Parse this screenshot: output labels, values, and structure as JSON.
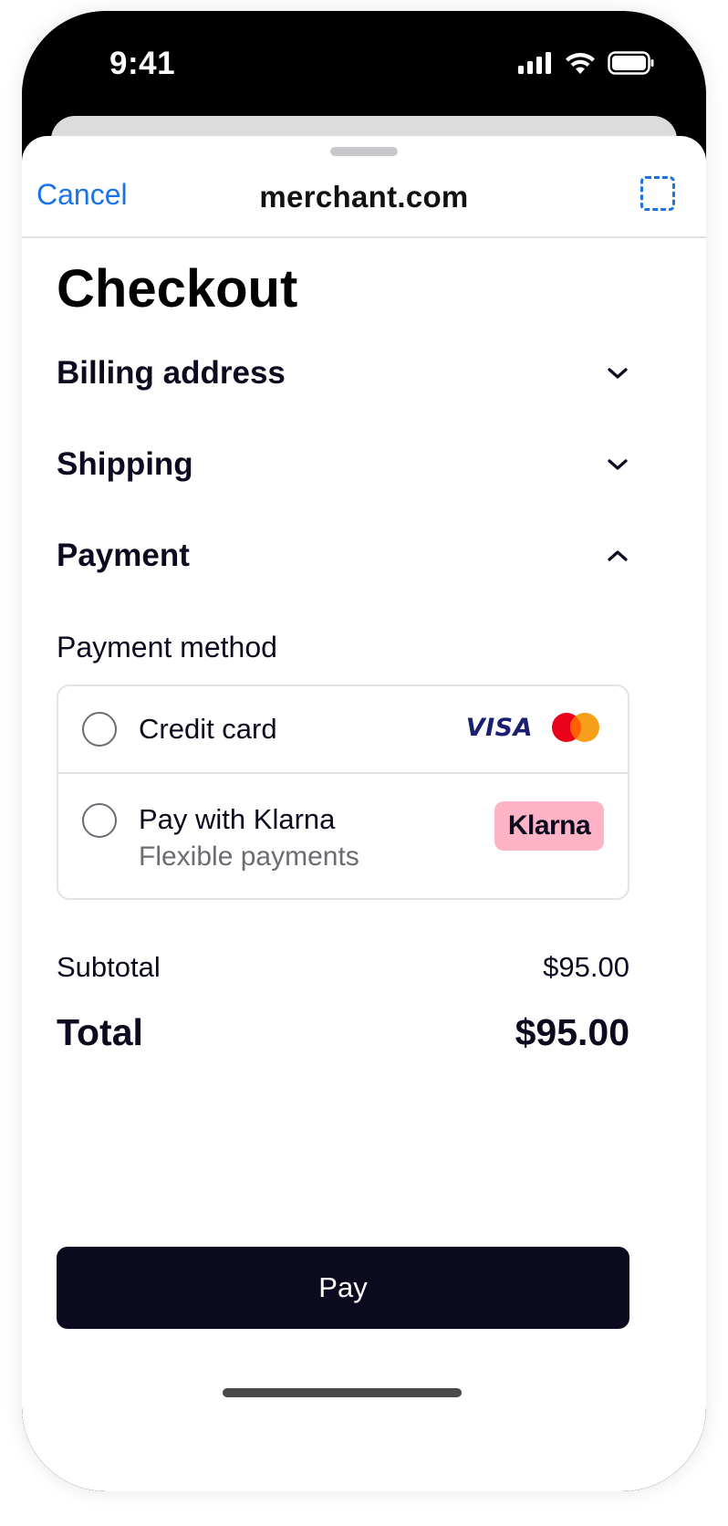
{
  "status_bar": {
    "time": "9:41"
  },
  "nav": {
    "cancel_label": "Cancel",
    "domain": "merchant.com"
  },
  "page": {
    "title": "Checkout"
  },
  "sections": [
    {
      "title": "Billing address",
      "state": "collapsed"
    },
    {
      "title": "Shipping",
      "state": "collapsed"
    },
    {
      "title": "Payment",
      "state": "expanded"
    }
  ],
  "payment": {
    "method_label": "Payment method",
    "methods": [
      {
        "label": "Credit card",
        "selected": false,
        "logos": [
          "VISA",
          "mastercard"
        ]
      },
      {
        "label": "Pay with Klarna",
        "sublabel": "Flexible payments",
        "selected": false,
        "badge": "Klarna"
      }
    ]
  },
  "summary": {
    "subtotal_label": "Subtotal",
    "subtotal_value": "$95.00",
    "total_label": "Total",
    "total_value": "$95.00"
  },
  "pay_button_label": "Pay",
  "colors": {
    "accent": "#1a73e8",
    "primary_dark": "#0b0a1f",
    "klarna_pink": "#ffb3c7",
    "visa_blue": "#1a1f71",
    "mastercard_red": "#eb001b",
    "mastercard_orange": "#f79e1b"
  }
}
